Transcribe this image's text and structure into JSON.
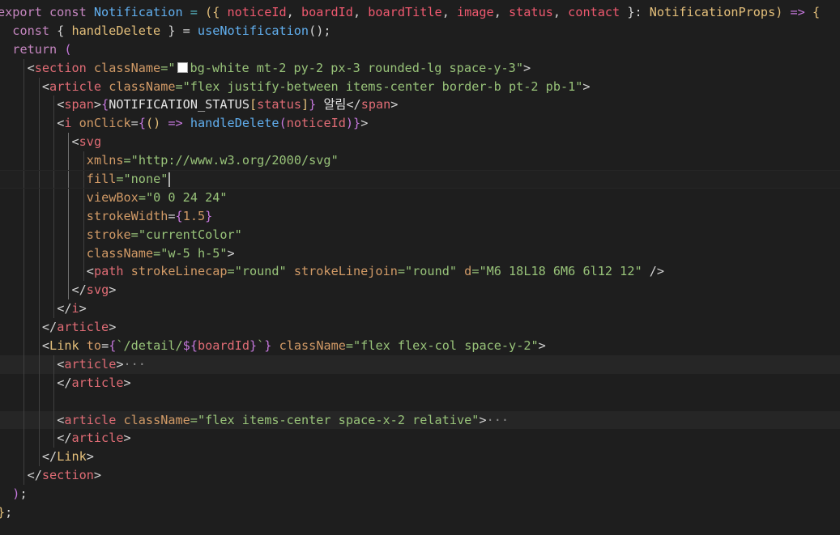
{
  "editor": {
    "language": "tsx",
    "theme": "dark",
    "colors": {
      "background": "#1e1e1e",
      "current_line": "#202020",
      "highlight_line": "#262626",
      "indent_guide": "#404040",
      "indent_guide_active": "#707070",
      "keyword": "#c586c0",
      "identifier": "#dcdcaa",
      "parameter": "#ef596f",
      "tag": "#e5c07b",
      "tag_punct": "#d19a66",
      "attribute": "#d7ba7d",
      "string": "#98c379",
      "number": "#d19a66",
      "punctuation": "#d4d4d4",
      "brace": "#c678dd",
      "function": "#61afef",
      "text": "#e5e5e5",
      "fold": "#8a8a8a"
    },
    "lines": [
      {
        "indent": 0,
        "tokens": [
          [
            "export const ",
            "#c586c0"
          ],
          [
            "Notification",
            "#61afef"
          ],
          [
            " = ",
            "#56b6c2"
          ],
          [
            "({ ",
            "#e5c07b"
          ],
          [
            "noticeId",
            "#ef596f"
          ],
          [
            ", ",
            "#d4d4d4"
          ],
          [
            "boardId",
            "#ef596f"
          ],
          [
            ", ",
            "#d4d4d4"
          ],
          [
            "boardTitle",
            "#ef596f"
          ],
          [
            ", ",
            "#d4d4d4"
          ],
          [
            "image",
            "#ef596f"
          ],
          [
            ", ",
            "#d4d4d4"
          ],
          [
            "status",
            "#ef596f"
          ],
          [
            ", ",
            "#d4d4d4"
          ],
          [
            "contact",
            "#ef596f"
          ],
          [
            " }: ",
            "#d4d4d4"
          ],
          [
            "NotificationProps",
            "#e5c07b"
          ],
          [
            ") ",
            "#e5c07b"
          ],
          [
            "=> ",
            "#c678dd"
          ],
          [
            "{",
            "#e5c07b"
          ]
        ]
      },
      {
        "indent": 1,
        "tokens": [
          [
            "const ",
            "#c586c0"
          ],
          [
            "{ ",
            "#d4d4d4"
          ],
          [
            "handleDelete",
            "#e5c07b"
          ],
          [
            " } = ",
            "#d4d4d4"
          ],
          [
            "useNotification",
            "#61afef"
          ],
          [
            "();",
            "#d4d4d4"
          ]
        ]
      },
      {
        "indent": 1,
        "tokens": [
          [
            "return ",
            "#c586c0"
          ],
          [
            "(",
            "#c678dd"
          ]
        ]
      },
      {
        "indent": 2,
        "tokens": [
          [
            "<",
            "#d4d4d4"
          ],
          [
            "section",
            "#e06c75"
          ],
          [
            " className",
            "#d19a66"
          ],
          [
            "=\"",
            "#98c379"
          ],
          [
            "SWATCH",
            ""
          ],
          [
            "bg-white mt-2 py-2 px-3 rounded-lg space-y-3\"",
            "#98c379"
          ],
          [
            ">",
            "#d4d4d4"
          ]
        ]
      },
      {
        "indent": 3,
        "tokens": [
          [
            "<",
            "#d4d4d4"
          ],
          [
            "article",
            "#e06c75"
          ],
          [
            " className",
            "#d19a66"
          ],
          [
            "=\"flex justify-between items-center border-b pt-2 pb-1\"",
            "#98c379"
          ],
          [
            ">",
            "#d4d4d4"
          ]
        ]
      },
      {
        "indent": 4,
        "tokens": [
          [
            "<",
            "#d4d4d4"
          ],
          [
            "span",
            "#e06c75"
          ],
          [
            ">",
            "#d4d4d4"
          ],
          [
            "{",
            "#c678dd"
          ],
          [
            "NOTIFICATION_STATUS",
            "#e5e5e5"
          ],
          [
            "[",
            "#e5c07b"
          ],
          [
            "status",
            "#e06c75"
          ],
          [
            "]",
            "#e5c07b"
          ],
          [
            "}",
            "#c678dd"
          ],
          [
            " 알림",
            "#e5e5e5"
          ],
          [
            "</",
            "#d4d4d4"
          ],
          [
            "span",
            "#e06c75"
          ],
          [
            ">",
            "#d4d4d4"
          ]
        ]
      },
      {
        "indent": 4,
        "tokens": [
          [
            "<",
            "#d4d4d4"
          ],
          [
            "i",
            "#e06c75"
          ],
          [
            " onClick",
            "#d19a66"
          ],
          [
            "=",
            "#d4d4d4"
          ],
          [
            "{",
            "#c678dd"
          ],
          [
            "() ",
            "#e5c07b"
          ],
          [
            "=> ",
            "#c678dd"
          ],
          [
            "handleDelete",
            "#61afef"
          ],
          [
            "(",
            "#c678dd"
          ],
          [
            "noticeId",
            "#e06c75"
          ],
          [
            ")",
            "#c678dd"
          ],
          [
            "}",
            "#c678dd"
          ],
          [
            ">",
            "#d4d4d4"
          ]
        ]
      },
      {
        "indent": 5,
        "tokens": [
          [
            "<",
            "#d4d4d4"
          ],
          [
            "svg",
            "#e06c75"
          ]
        ]
      },
      {
        "indent": 6,
        "tokens": [
          [
            "xmlns",
            "#d19a66"
          ],
          [
            "=\"",
            "#98c379"
          ],
          [
            "http://www.w3.org/2000/svg",
            "#98c379"
          ],
          [
            "\"",
            "#98c379"
          ]
        ]
      },
      {
        "indent": 6,
        "current": true,
        "tokens": [
          [
            "fill",
            "#d19a66"
          ],
          [
            "=\"none\"",
            "#98c379"
          ],
          [
            "CURSOR",
            ""
          ]
        ]
      },
      {
        "indent": 6,
        "tokens": [
          [
            "viewBox",
            "#d19a66"
          ],
          [
            "=\"0 0 24 24\"",
            "#98c379"
          ]
        ]
      },
      {
        "indent": 6,
        "tokens": [
          [
            "strokeWidth",
            "#d19a66"
          ],
          [
            "=",
            "#d4d4d4"
          ],
          [
            "{",
            "#c678dd"
          ],
          [
            "1.5",
            "#d19a66"
          ],
          [
            "}",
            "#c678dd"
          ]
        ]
      },
      {
        "indent": 6,
        "tokens": [
          [
            "stroke",
            "#d19a66"
          ],
          [
            "=\"currentColor\"",
            "#98c379"
          ]
        ]
      },
      {
        "indent": 6,
        "tokens": [
          [
            "className",
            "#d19a66"
          ],
          [
            "=\"w-5 h-5\"",
            "#98c379"
          ],
          [
            ">",
            "#d4d4d4"
          ]
        ]
      },
      {
        "indent": 6,
        "tokens": [
          [
            "<",
            "#d4d4d4"
          ],
          [
            "path",
            "#e06c75"
          ],
          [
            " strokeLinecap",
            "#d19a66"
          ],
          [
            "=\"round\"",
            "#98c379"
          ],
          [
            " strokeLinejoin",
            "#d19a66"
          ],
          [
            "=\"round\"",
            "#98c379"
          ],
          [
            " d",
            "#d19a66"
          ],
          [
            "=\"M6 18L18 6M6 6l12 12\"",
            "#98c379"
          ],
          [
            " />",
            "#d4d4d4"
          ]
        ]
      },
      {
        "indent": 5,
        "tokens": [
          [
            "</",
            "#d4d4d4"
          ],
          [
            "svg",
            "#e06c75"
          ],
          [
            ">",
            "#d4d4d4"
          ]
        ]
      },
      {
        "indent": 4,
        "tokens": [
          [
            "</",
            "#d4d4d4"
          ],
          [
            "i",
            "#e06c75"
          ],
          [
            ">",
            "#d4d4d4"
          ]
        ]
      },
      {
        "indent": 3,
        "tokens": [
          [
            "</",
            "#d4d4d4"
          ],
          [
            "article",
            "#e06c75"
          ],
          [
            ">",
            "#d4d4d4"
          ]
        ]
      },
      {
        "indent": 3,
        "tokens": [
          [
            "<",
            "#d4d4d4"
          ],
          [
            "Link",
            "#e5c07b"
          ],
          [
            " to",
            "#d19a66"
          ],
          [
            "=",
            "#d4d4d4"
          ],
          [
            "{",
            "#c678dd"
          ],
          [
            "`/detail/",
            "#98c379"
          ],
          [
            "${",
            "#c678dd"
          ],
          [
            "boardId",
            "#e06c75"
          ],
          [
            "}",
            "#c678dd"
          ],
          [
            "`",
            "#98c379"
          ],
          [
            "}",
            "#c678dd"
          ],
          [
            " className",
            "#d19a66"
          ],
          [
            "=\"flex flex-col space-y-2\"",
            "#98c379"
          ],
          [
            ">",
            "#d4d4d4"
          ]
        ]
      },
      {
        "indent": 4,
        "highlight": true,
        "tokens": [
          [
            "<",
            "#d4d4d4"
          ],
          [
            "article",
            "#e06c75"
          ],
          [
            ">",
            "#d4d4d4"
          ],
          [
            "···",
            "#8a8a8a"
          ]
        ]
      },
      {
        "indent": 4,
        "tokens": [
          [
            "</",
            "#d4d4d4"
          ],
          [
            "article",
            "#e06c75"
          ],
          [
            ">",
            "#d4d4d4"
          ]
        ]
      },
      {
        "indent": 4,
        "tokens": []
      },
      {
        "indent": 4,
        "highlight": true,
        "tokens": [
          [
            "<",
            "#d4d4d4"
          ],
          [
            "article",
            "#e06c75"
          ],
          [
            " className",
            "#d19a66"
          ],
          [
            "=\"flex items-center space-x-2 relative\"",
            "#98c379"
          ],
          [
            ">",
            "#d4d4d4"
          ],
          [
            "···",
            "#8a8a8a"
          ]
        ]
      },
      {
        "indent": 4,
        "tokens": [
          [
            "</",
            "#d4d4d4"
          ],
          [
            "article",
            "#e06c75"
          ],
          [
            ">",
            "#d4d4d4"
          ]
        ]
      },
      {
        "indent": 3,
        "tokens": [
          [
            "</",
            "#d4d4d4"
          ],
          [
            "Link",
            "#e5c07b"
          ],
          [
            ">",
            "#d4d4d4"
          ]
        ]
      },
      {
        "indent": 2,
        "tokens": [
          [
            "</",
            "#d4d4d4"
          ],
          [
            "section",
            "#e06c75"
          ],
          [
            ">",
            "#d4d4d4"
          ]
        ]
      },
      {
        "indent": 1,
        "tokens": [
          [
            ")",
            "#c678dd"
          ],
          [
            ";",
            "#d4d4d4"
          ]
        ]
      },
      {
        "indent": 0,
        "tokens": [
          [
            "}",
            "#e5c07b"
          ],
          [
            ";",
            "#d4d4d4"
          ]
        ]
      }
    ]
  }
}
